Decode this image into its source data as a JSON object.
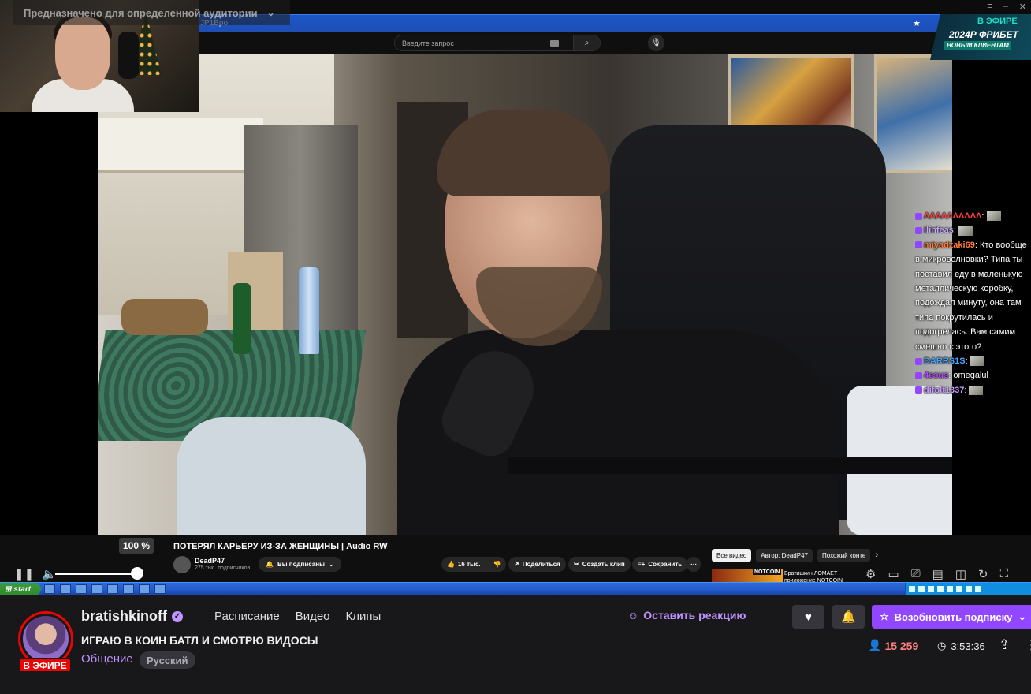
{
  "overlay": {
    "audience_label": "Предназначено для определенной аудитории"
  },
  "browser": {
    "url_fragment": "JP1Bpo"
  },
  "youtube": {
    "search_placeholder": "Введите запрос",
    "volume_label": "100 %",
    "video_title": "ПОТЕРЯЛ КАРЬЕРУ ИЗ-ЗА ЖЕНЩИНЫ | Audio RW",
    "channel_name": "DeadP47",
    "channel_subs": "275 тыс. подписчиков",
    "subscribed_label": "Вы подписаны",
    "likes": "16 тыс.",
    "share_label": "Поделиться",
    "clip_label": "Создать клип",
    "save_label": "Сохранить",
    "chips": [
      "Все видео",
      "Автор: DeadP47",
      "Похожий конте"
    ],
    "rec_tag": "NOTCOIN",
    "rec_title": "Братишкин ЛОМАЕТ приложение NOTCOIN"
  },
  "ad": {
    "badge": "В ЭФИРЕ",
    "amount": "2024Р",
    "brand": "ФРИБЕТ",
    "tagline": "НОВЫМ КЛИЕНТАМ"
  },
  "chat": [
    {
      "user": "ΛΛΛΛΛΛΛΛΛΛ",
      "text": "",
      "color": "#ff4040"
    },
    {
      "user": "ilinfeas",
      "text": "",
      "color": "#c8a8ff"
    },
    {
      "user": "miyadzaki69",
      "text": "Кто вообще в микроволновки? Типа ты поставил еду в маленькую металлическую коробку, подождал минуту, она там типа покрутилась и подогрелась. Вам самим смешно с этого?",
      "color": "#ff7a3d"
    },
    {
      "user": "DARRS1S",
      "text": "",
      "color": "#4da3ff"
    },
    {
      "user": "4esus",
      "text": "omegalul",
      "color": "#b34dff"
    },
    {
      "user": "difolt1337",
      "text": "",
      "color": "#c79bff"
    }
  ],
  "taskbar": {
    "start_label": "start"
  },
  "channel": {
    "name": "bratishkinoff",
    "live_label": "В ЭФИРЕ",
    "nav": [
      "Расписание",
      "Видео",
      "Клипы"
    ],
    "stream_title": "ИГРАЮ В КОИН БАТЛ И СМОТРЮ ВИДОСЫ",
    "category": "Общение",
    "language_tag": "Русский",
    "react_label": "Оставить реакцию",
    "resub_label": "Возобновить подписку",
    "viewers": "15 259",
    "uptime": "3:53:36"
  },
  "colors": {
    "accent": "#9147ff",
    "live": "#eb0400",
    "viewers": "#ff8280"
  }
}
